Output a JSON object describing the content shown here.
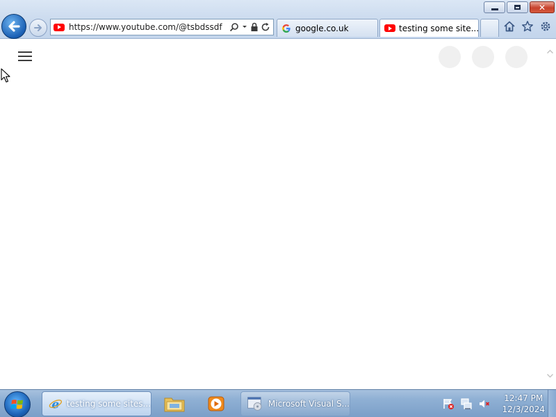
{
  "window": {
    "address_url": "https://www.youtube.com/@tsbdssdf",
    "tabs": [
      {
        "label": "google.co.uk",
        "icon": "google-icon",
        "active": false
      },
      {
        "label": "testing some site...",
        "icon": "youtube-icon",
        "active": true
      }
    ]
  },
  "page": {
    "menu_icon": "hamburger-menu-icon",
    "skeleton_avatars": 3
  },
  "taskbar": {
    "buttons": [
      {
        "label": "testing some sites...",
        "icon": "internet-explorer-icon",
        "active": true
      },
      {
        "label": "",
        "icon": "file-explorer-icon",
        "active": false
      },
      {
        "label": "",
        "icon": "media-player-icon",
        "active": false
      },
      {
        "label": "Microsoft Visual S...",
        "icon": "visual-studio-installer-icon",
        "active": false
      }
    ],
    "clock": {
      "time": "12:47 PM",
      "date": "12/3/2024"
    }
  },
  "colors": {
    "youtube_red": "#ff0000",
    "ie_blue": "#1a5fb4",
    "taskbar": "#8fb0d4"
  }
}
